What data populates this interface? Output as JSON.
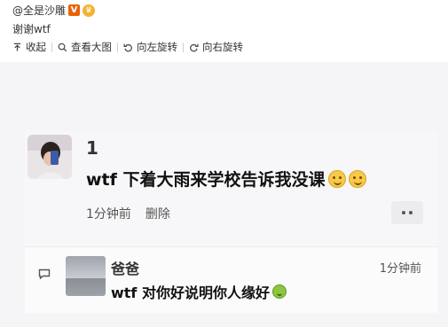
{
  "post": {
    "author": "@全是沙雕",
    "caption": "谢谢wtf",
    "badge_v": "V",
    "badge_crown": "♛"
  },
  "toolbar": {
    "items": [
      {
        "label": "收起",
        "icon": "collapse-icon"
      },
      {
        "label": "查看大图",
        "icon": "search-icon"
      },
      {
        "label": "向左旋转",
        "icon": "rotate-left-icon"
      },
      {
        "label": "向右旋转",
        "icon": "rotate-right-icon"
      }
    ]
  },
  "comment": {
    "username": "1",
    "message": "wtf 下着大雨来学校告诉我没课",
    "time": "1分钟前",
    "delete_label": "删除",
    "more_icon": "more-icon"
  },
  "reply": {
    "username": "爸爸",
    "time": "1分钟前",
    "message": "wtf 对你好说明你人缘好",
    "reply_icon": "reply-icon"
  },
  "colors": {
    "background": "#f5f5f7",
    "badge_orange": "#e8630a",
    "crown_gold": "#f3b232"
  }
}
